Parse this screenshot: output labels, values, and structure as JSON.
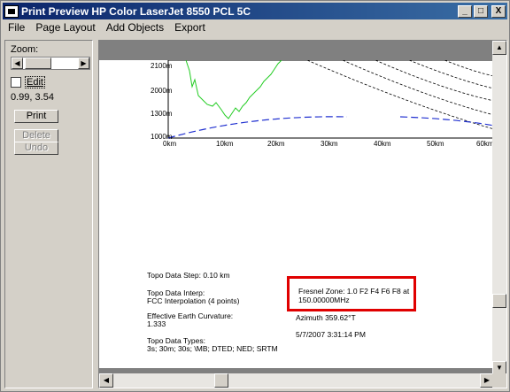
{
  "window": {
    "title": "Print Preview HP Color LaserJet 8550 PCL 5C",
    "controls": {
      "minimize": "_",
      "maximize": "□",
      "close": "X"
    }
  },
  "menu": [
    "File",
    "Page Layout",
    "Add Objects",
    "Export"
  ],
  "left_panel": {
    "zoom_label": "Zoom:",
    "edit_label": "Edit",
    "edit_checked": false,
    "coords": "0.99, 3.54",
    "print_button": "Print",
    "delete_button": "Delete",
    "undo_button": "Undo"
  },
  "chart": {
    "y_ticks": [
      "2100m",
      "2000m",
      "1300m",
      "1000m"
    ],
    "x_ticks": [
      "0km",
      "10km",
      "20km",
      "30km",
      "40km",
      "50km",
      "60km"
    ],
    "colors": {
      "terrain": "#22cc22",
      "earth_curve": "#2030d0",
      "fresnel": "#000000"
    }
  },
  "page_text": {
    "topo_step": "Topo Data Step: 0.10 km",
    "topo_interp_label": "Topo Data Interp:",
    "topo_interp_value": "FCC Interpolation (4 points)",
    "earth_curv_label": "Effective Earth Curvature:",
    "earth_curv_value": "1.333",
    "topo_types_label": "Topo Data Types:",
    "topo_types_value": "3s; 30m; 30s; \\MB; DTED; NED; SRTM",
    "fresnel_line1": "Fresnel Zone: 1.0  F2  F4 F6 F8  at",
    "fresnel_line2": "150.00000MHz",
    "azimuth": "Azimuth 359.62°T",
    "timestamp": "5/7/2007 3:31:14 PM"
  },
  "highlight_color": "#e00000"
}
